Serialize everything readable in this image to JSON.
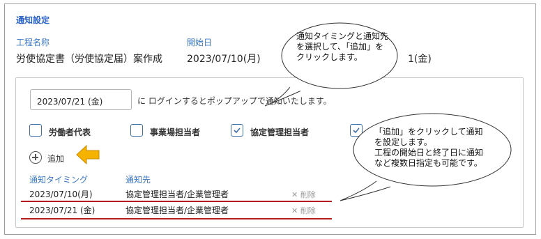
{
  "section_title": "通知設定",
  "process": {
    "name_label": "工程名称",
    "name_value": "労使協定書（労使協定届）案作成",
    "start_label": "開始日",
    "start_value": "2023/07/10(月)",
    "end_value_partial": "1(金)"
  },
  "notify": {
    "date_value": "2023/07/21 (金)",
    "suffix_text": "に  ログインするとポップアップで通知いたします。"
  },
  "recipients": [
    {
      "label": "労働者代表",
      "checked": false
    },
    {
      "label": "事業場担当者",
      "checked": false
    },
    {
      "label": "協定管理担当者",
      "checked": true
    },
    {
      "label": "",
      "checked": true
    }
  ],
  "add_label": "追加",
  "table": {
    "headers": [
      "通知タイミング",
      "通知先"
    ],
    "rows": [
      {
        "timing": "2023/07/10(月)",
        "target": "協定管理担当者/企業管理者",
        "delete": "削除"
      },
      {
        "timing": "2023/07/21 (金)",
        "target": "協定管理担当者/企業管理者",
        "delete": "削除"
      }
    ]
  },
  "callouts": {
    "top": [
      "通知タイミングと通知先",
      "を選択して、「追加」を",
      "クリックします。"
    ],
    "right": [
      "「追加」をクリックして通知",
      "を設定します。",
      "工程の開始日と終了日に通知",
      "など複数日指定も可能です。"
    ]
  },
  "colors": {
    "accent": "#3a78c3",
    "highlight_arrow": "#f6b200",
    "underline": "#b71c1c"
  }
}
